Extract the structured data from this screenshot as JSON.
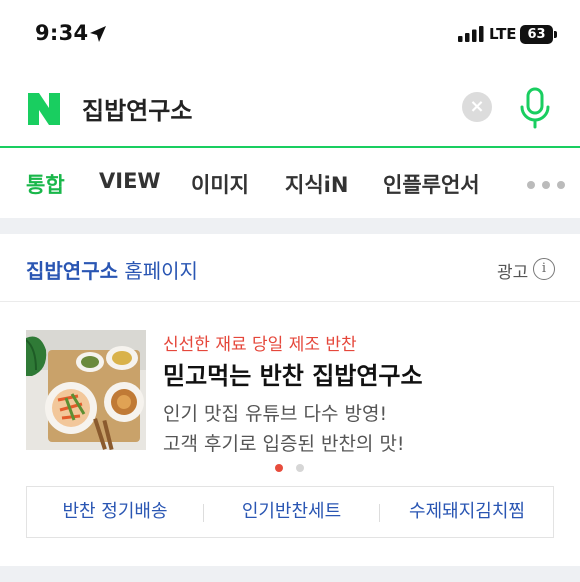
{
  "status_bar": {
    "time": "9:34",
    "network": "LTE",
    "battery": "63"
  },
  "search": {
    "logo": "N",
    "query": "집밥연구소",
    "brand_color": "#19ce60"
  },
  "tabs": [
    {
      "label": "통합",
      "active": true
    },
    {
      "label": "VIEW",
      "active": false
    },
    {
      "label": "이미지",
      "active": false
    },
    {
      "label": "지식iN",
      "active": false
    },
    {
      "label": "인플루언서",
      "active": false
    }
  ],
  "ad": {
    "site_name": "집밥연구소",
    "site_suffix": "홈페이지",
    "ad_label": "광고",
    "info_icon": "i",
    "promo": "신선한 재료 당일 제조 반찬",
    "headline": "믿고먹는 반찬 집밥연구소",
    "description_1": "인기 맛집 유튜브 다수 방영!",
    "description_2": "고객 후기로 입증된 반찬의 맛!",
    "carousel_total": 2,
    "carousel_active": 1,
    "links": [
      "반찬 정기배송",
      "인기반찬세트",
      "수제돼지김치찜"
    ]
  }
}
